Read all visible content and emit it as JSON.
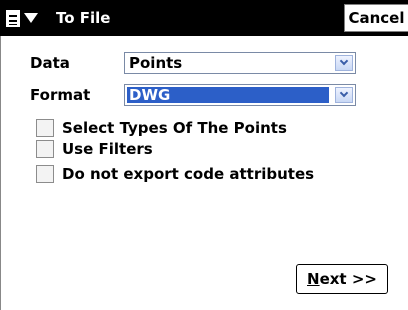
{
  "titlebar": {
    "menu_icon": "document-menu-icon",
    "title": "To File",
    "cancel_label": "Cancel"
  },
  "form": {
    "data_label": "Data",
    "data_value": "Points",
    "format_label": "Format",
    "format_value": "DWG"
  },
  "options": [
    {
      "label": "Select Types Of The Points",
      "checked": false
    },
    {
      "label": "Use Filters",
      "checked": false
    },
    {
      "label": "Do not export code attributes",
      "checked": false
    }
  ],
  "footer": {
    "next_mnemonic": "N",
    "next_rest": "ext >>"
  },
  "colors": {
    "titlebar_bg": "#000000",
    "selection_bg": "#2c5fc8"
  }
}
